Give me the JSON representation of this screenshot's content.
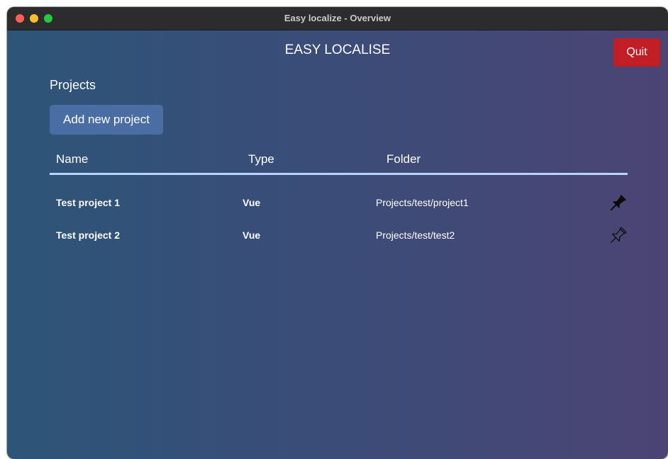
{
  "window": {
    "title": "Easy localize - Overview"
  },
  "header": {
    "app_title": "EASY LOCALISE",
    "quit_label": "Quit"
  },
  "projects": {
    "section_title": "Projects",
    "add_label": "Add new project",
    "columns": [
      "Name",
      "Type",
      "Folder"
    ],
    "rows": [
      {
        "name": "Test project 1",
        "type": "Vue",
        "folder": "Projects/test/project1",
        "pinned": true,
        "pin_icon": "pin-filled-icon"
      },
      {
        "name": "Test project 2",
        "type": "Vue",
        "folder": "Projects/test/test2",
        "pinned": false,
        "pin_icon": "pin-outline-icon"
      }
    ]
  },
  "colors": {
    "quit": "#c21e25",
    "add_button": "#4a6da3",
    "header_rule": "#b9d5ff",
    "background_start": "#2d5577",
    "background_end": "#4b4474"
  }
}
